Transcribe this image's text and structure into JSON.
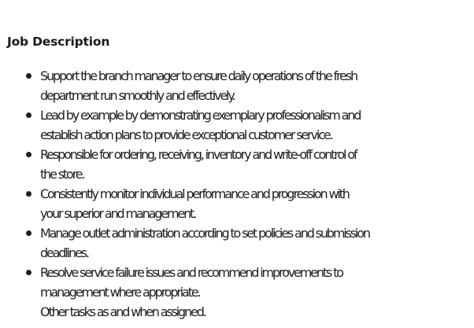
{
  "job_description": {
    "title": "Job Description",
    "items": [
      {
        "lines": [
          "Support the branch manager to ensure daily operations of the fresh",
          "department run smoothly and effectively."
        ]
      },
      {
        "lines": [
          "Lead by example by demonstrating exemplary professionalism and",
          "establish action plans to provide exceptional customer service."
        ]
      },
      {
        "lines": [
          "Responsible for ordering, receiving, inventory and write-off control of",
          "the store."
        ]
      },
      {
        "lines": [
          "Consistently monitor individual performance and progression with",
          "your superior and management."
        ]
      },
      {
        "lines": [
          "Manage outlet administration according to set policies and submission",
          "deadlines."
        ]
      },
      {
        "lines": [
          "Resolve service failure issues and recommend improvements to",
          "management where appropriate.",
          "Other tasks as and when assigned."
        ]
      }
    ]
  }
}
